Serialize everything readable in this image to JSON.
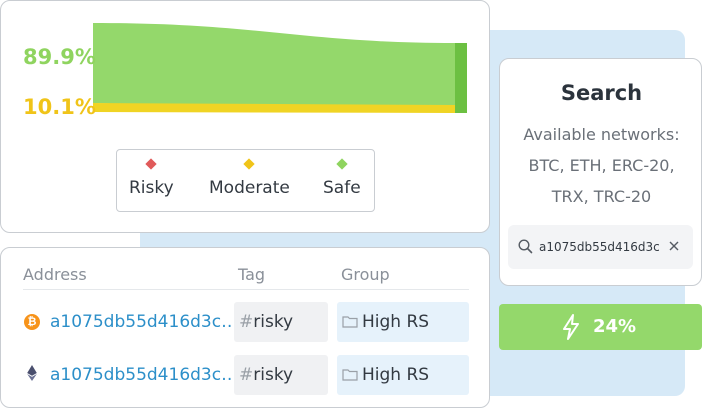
{
  "flow": {
    "safe_percent": "89.9%",
    "moderate_percent": "10.1%",
    "safe_fraction": 0.899,
    "moderate_fraction": 0.101
  },
  "legend": {
    "items": [
      {
        "label": "Risky",
        "color": "#e05a5a"
      },
      {
        "label": "Moderate",
        "color": "#f0c419"
      },
      {
        "label": "Safe",
        "color": "#8fd45f"
      }
    ]
  },
  "table": {
    "headers": {
      "address": "Address",
      "tag": "Tag",
      "group": "Group"
    },
    "rows": [
      {
        "coin_icon": "bitcoin-icon",
        "address": "a1075db55d416d3c…",
        "tag_prefix": "#",
        "tag": "risky",
        "group": "High RS"
      },
      {
        "coin_icon": "ethereum-icon",
        "address": "a1075db55d416d3c…",
        "tag_prefix": "#",
        "tag": "risky",
        "group": "High RS"
      }
    ]
  },
  "search": {
    "title": "Search",
    "desc_line1": "Available networks:",
    "desc_line2": "BTC, ETH, ERC-20,",
    "desc_line3": "TRX, TRC-20",
    "value": "a1075db55d416d3c"
  },
  "score": {
    "value": "24%",
    "icon": "bolt-icon"
  },
  "colors": {
    "safe": "#94d86b",
    "moderate": "#f0c419",
    "risky": "#e05a5a",
    "link": "#2c8fc9",
    "panel_bg": "#d6e9f7"
  }
}
